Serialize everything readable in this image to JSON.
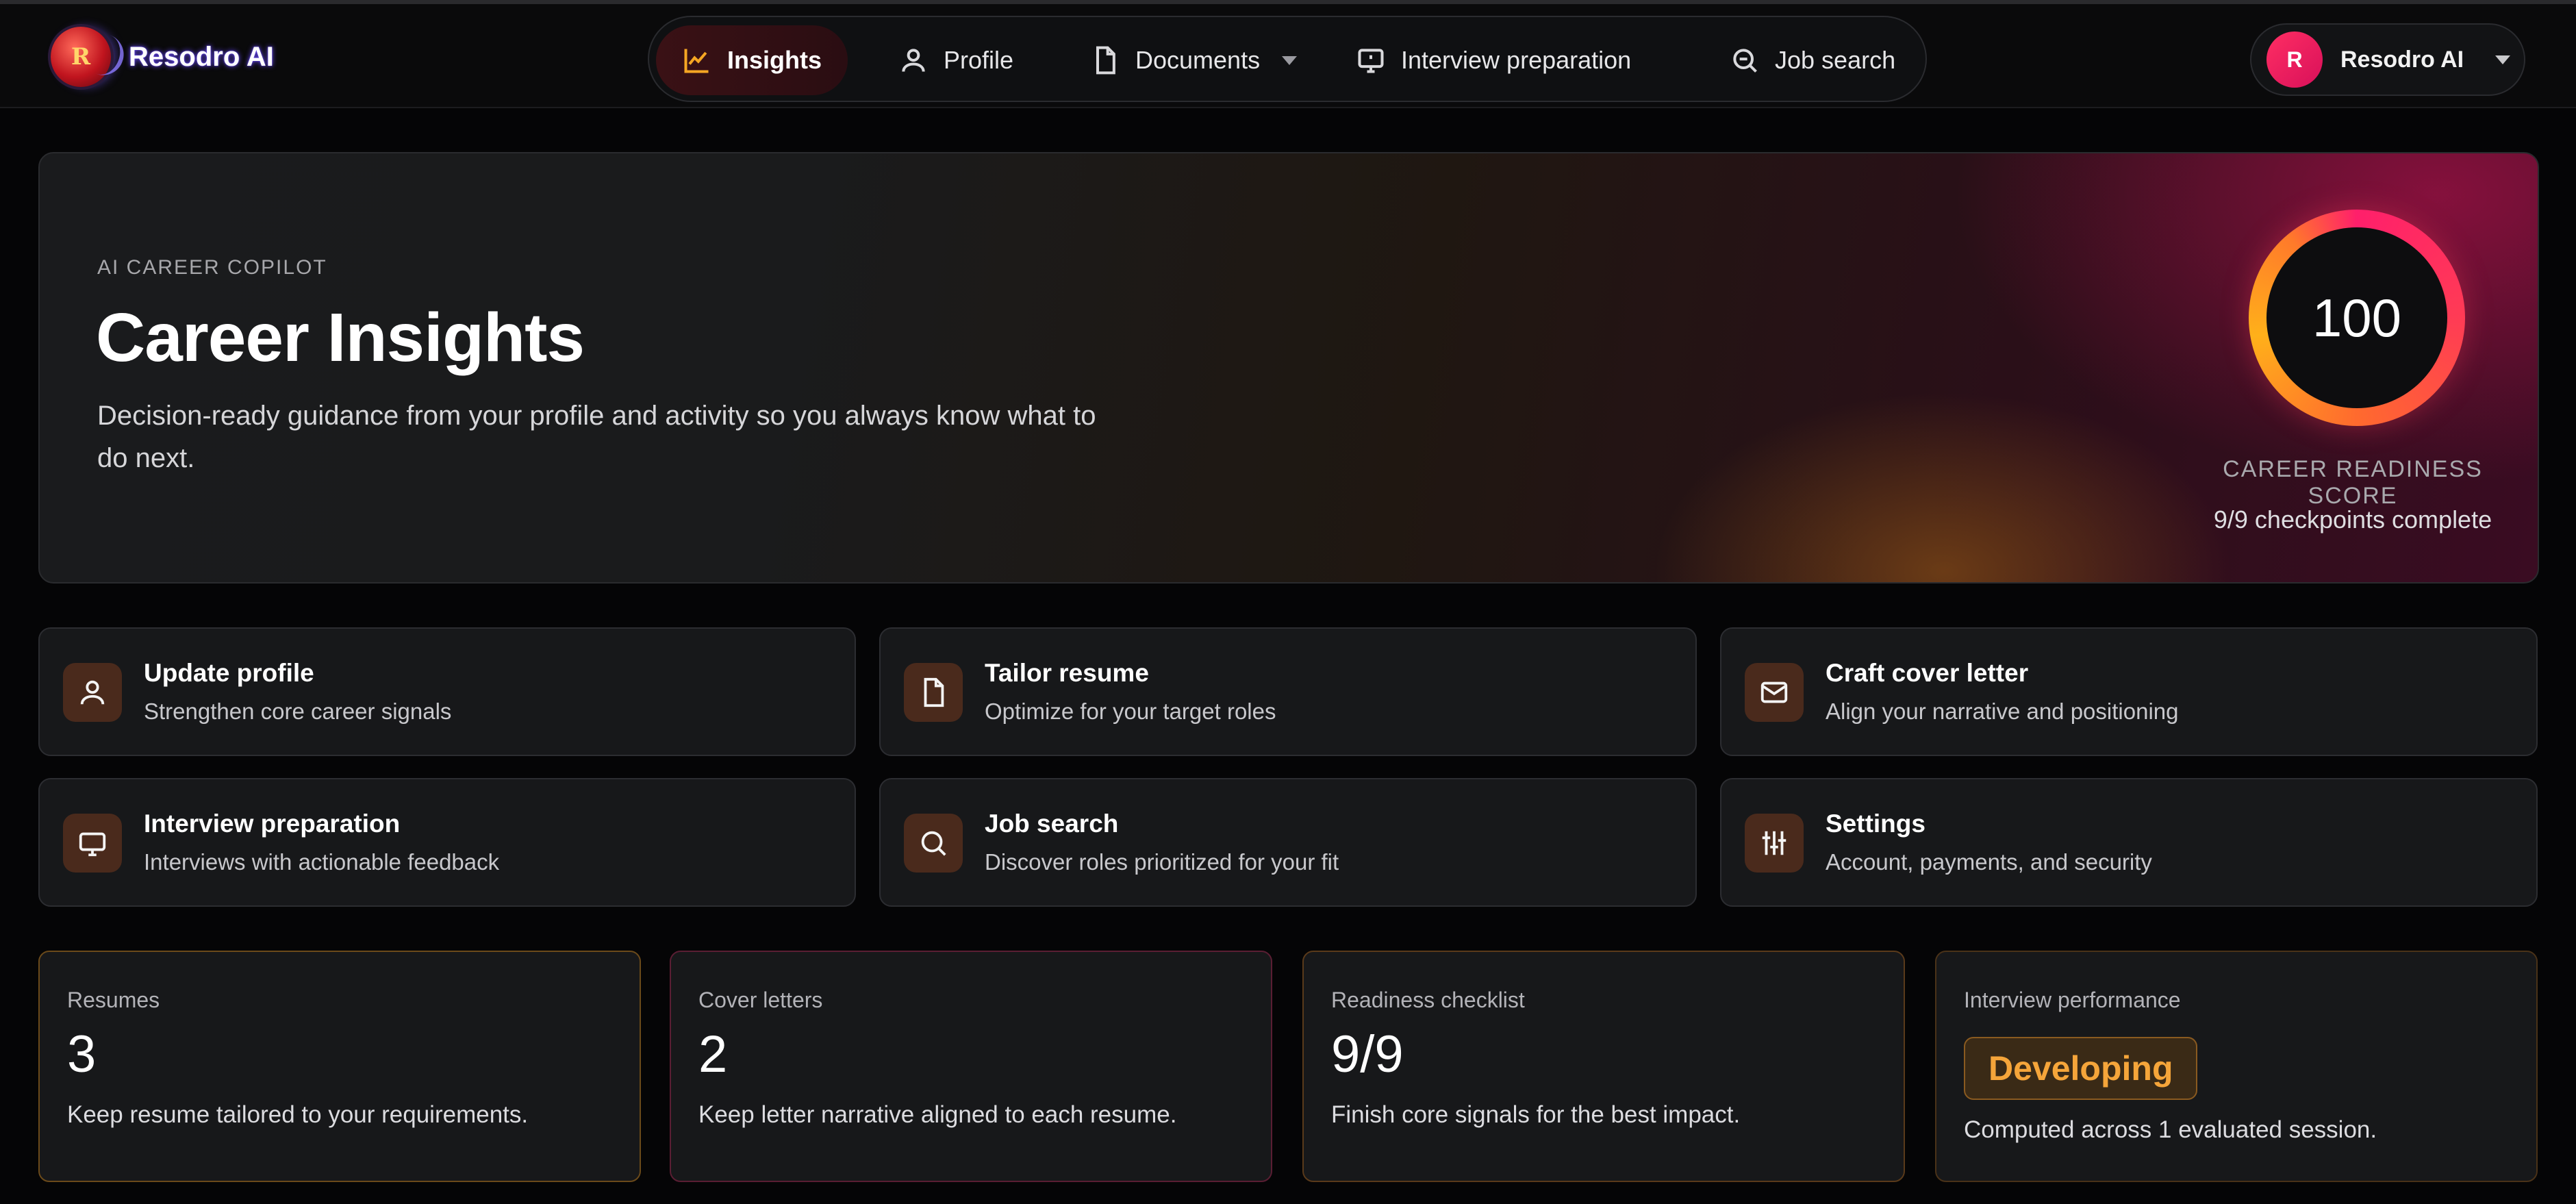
{
  "brand": {
    "name": "Resodro AI",
    "logo_letter": "R"
  },
  "nav": {
    "items": [
      {
        "label": "Insights",
        "icon": "chart-line-icon"
      },
      {
        "label": "Profile",
        "icon": "user-icon"
      },
      {
        "label": "Documents",
        "icon": "document-icon"
      },
      {
        "label": "Interview preparation",
        "icon": "monitor-icon"
      },
      {
        "label": "Job search",
        "icon": "search-icon"
      }
    ]
  },
  "user": {
    "initial": "R",
    "name": "Resodro AI"
  },
  "hero": {
    "eyebrow": "AI CAREER COPILOT",
    "title": "Career Insights",
    "description": "Decision-ready guidance from your profile and activity so you always know what to do next.",
    "score": {
      "value": "100",
      "label": "CAREER READINESS SCORE",
      "checkpoints": "9/9 checkpoints complete"
    }
  },
  "actions": [
    {
      "title": "Update profile",
      "subtitle": "Strengthen core career signals",
      "icon": "user-icon"
    },
    {
      "title": "Tailor resume",
      "subtitle": "Optimize for your target roles",
      "icon": "document-icon"
    },
    {
      "title": "Craft cover letter",
      "subtitle": "Align your narrative and positioning",
      "icon": "mail-icon"
    },
    {
      "title": "Interview preparation",
      "subtitle": "Interviews with actionable feedback",
      "icon": "monitor-icon"
    },
    {
      "title": "Job search",
      "subtitle": "Discover roles prioritized for your fit",
      "icon": "search-icon"
    },
    {
      "title": "Settings",
      "subtitle": "Account, payments, and security",
      "icon": "sliders-icon"
    }
  ],
  "stats": [
    {
      "label": "Resumes",
      "value": "3",
      "subtitle": "Keep resume tailored to your requirements.",
      "border_color": "#6b4a1a"
    },
    {
      "label": "Cover letters",
      "value": "2",
      "subtitle": "Keep letter narrative aligned to each resume.",
      "border_color": "#5a1e33"
    },
    {
      "label": "Readiness checklist",
      "value": "9/9",
      "subtitle": "Finish core signals for the best impact.",
      "border_color": "#5a3a1a"
    },
    {
      "label": "Interview performance",
      "badge": "Developing",
      "subtitle": "Computed across 1 evaluated session.",
      "border_color": "#4a3218"
    }
  ],
  "colors": {
    "accent_orange": "#f5a623",
    "accent_pink": "#ff1f6b",
    "background": "#050506",
    "card": "#17181a"
  }
}
